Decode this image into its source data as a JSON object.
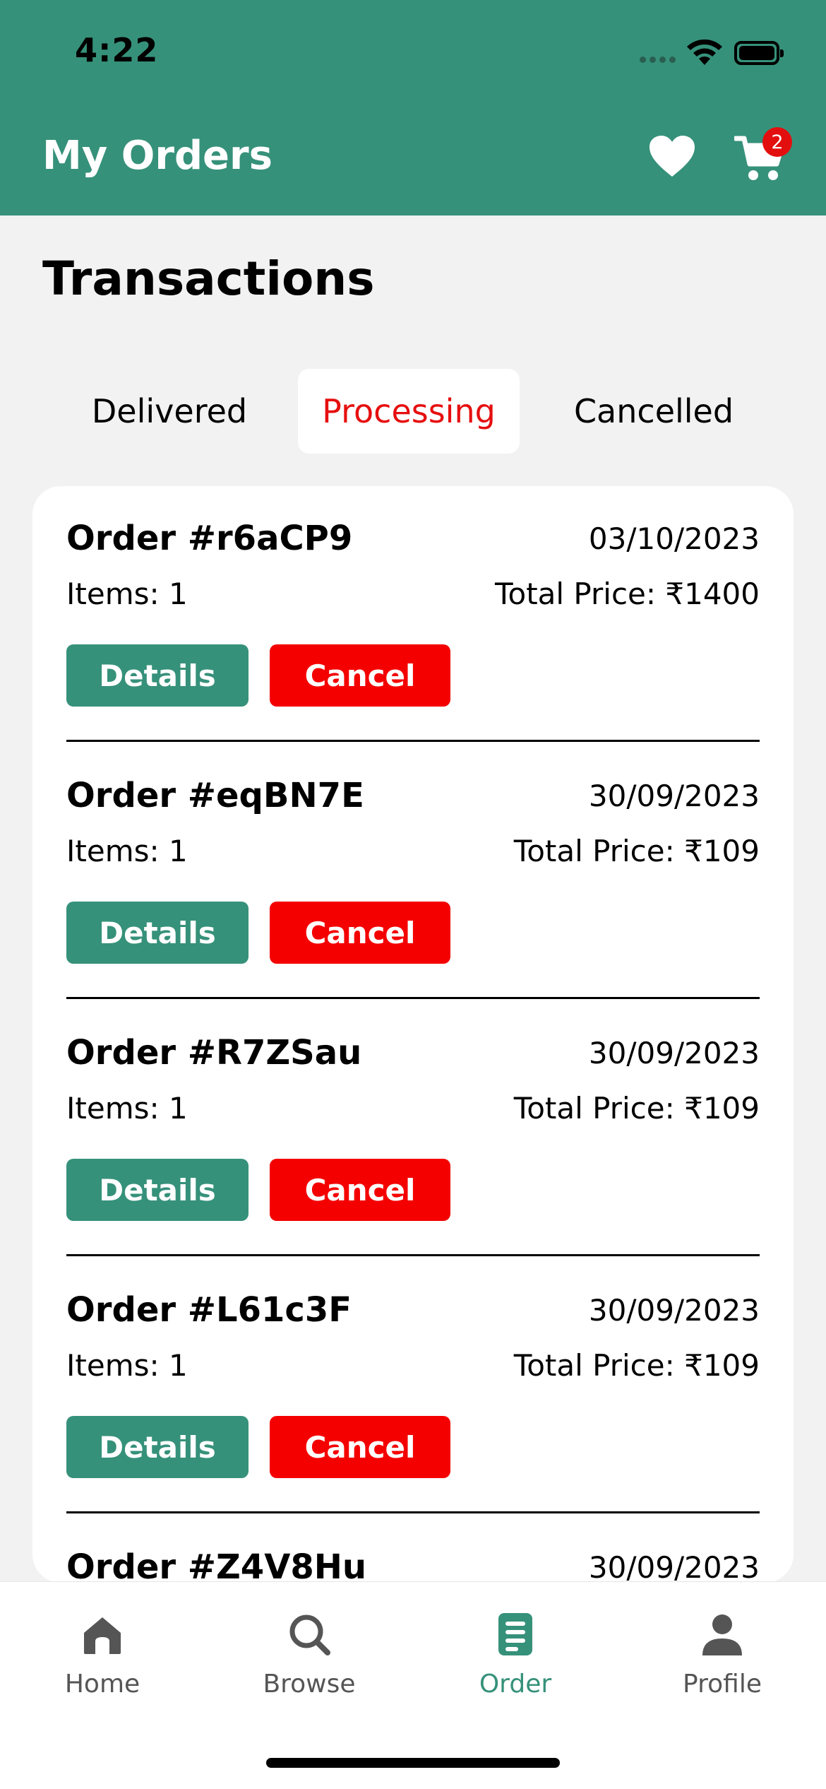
{
  "status_bar": {
    "time": "4:22"
  },
  "header": {
    "title": "My Orders",
    "cart_count": "2"
  },
  "section": {
    "title": "Transactions"
  },
  "tabs": [
    {
      "label": "Delivered",
      "active": false
    },
    {
      "label": "Processing",
      "active": true
    },
    {
      "label": "Cancelled",
      "active": false
    }
  ],
  "orders": [
    {
      "id": "Order #r6aCP9",
      "date": "03/10/2023",
      "items": "Items: 1",
      "total": "Total Price: ₹1400",
      "details_label": "Details",
      "cancel_label": "Cancel"
    },
    {
      "id": "Order #eqBN7E",
      "date": "30/09/2023",
      "items": "Items: 1",
      "total": "Total Price: ₹109",
      "details_label": "Details",
      "cancel_label": "Cancel"
    },
    {
      "id": "Order #R7ZSau",
      "date": "30/09/2023",
      "items": "Items: 1",
      "total": "Total Price: ₹109",
      "details_label": "Details",
      "cancel_label": "Cancel"
    },
    {
      "id": "Order #L61c3F",
      "date": "30/09/2023",
      "items": "Items: 1",
      "total": "Total Price: ₹109",
      "details_label": "Details",
      "cancel_label": "Cancel"
    },
    {
      "id": "Order #Z4V8Hu",
      "date": "30/09/2023",
      "items": "",
      "total": "",
      "details_label": "",
      "cancel_label": ""
    }
  ],
  "bottom_nav": [
    {
      "label": "Home",
      "icon": "home-icon",
      "active": false
    },
    {
      "label": "Browse",
      "icon": "search-icon",
      "active": false
    },
    {
      "label": "Order",
      "icon": "document-icon",
      "active": true
    },
    {
      "label": "Profile",
      "icon": "person-icon",
      "active": false
    }
  ],
  "colors": {
    "brand": "#36917a",
    "danger": "#f40000",
    "active_tab_text": "#e60f0f"
  }
}
